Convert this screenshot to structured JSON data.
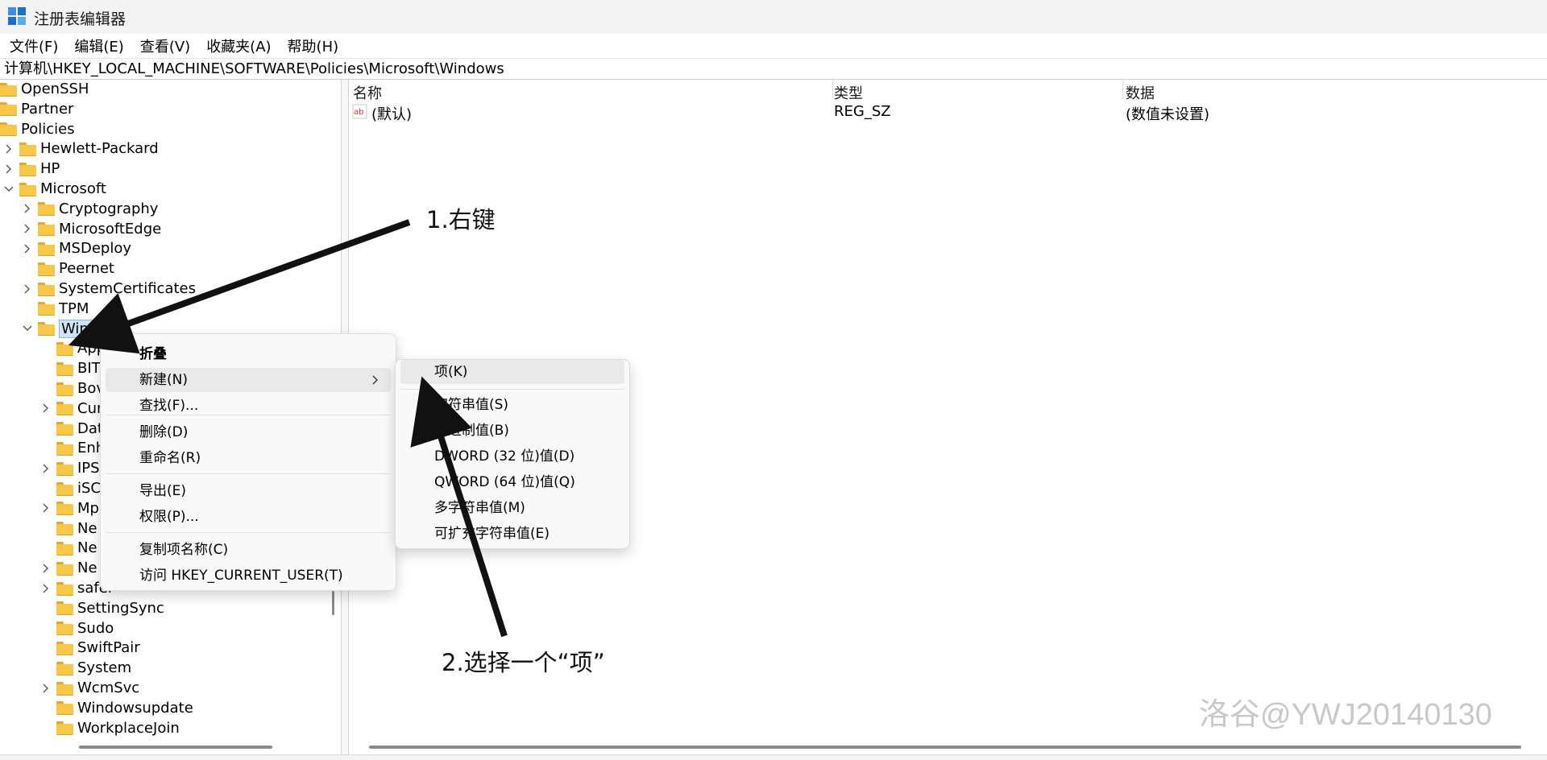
{
  "window": {
    "title": "注册表编辑器",
    "icon": "registry-editor-icon"
  },
  "menu": [
    {
      "label": "文件(F)"
    },
    {
      "label": "编辑(E)"
    },
    {
      "label": "查看(V)"
    },
    {
      "label": "收藏夹(A)"
    },
    {
      "label": "帮助(H)"
    }
  ],
  "address": "计算机\\HKEY_LOCAL_MACHINE\\SOFTWARE\\Policies\\Microsoft\\Windows",
  "tree": [
    {
      "label": "OpenSSH",
      "expander": "none"
    },
    {
      "label": "Partner",
      "expander": "none"
    },
    {
      "label": "Policies",
      "expander": "none"
    },
    {
      "label": "Hewlett-Packard",
      "expander": "collapsed"
    },
    {
      "label": "HP",
      "expander": "collapsed"
    },
    {
      "label": "Microsoft",
      "expander": "expanded"
    },
    {
      "label": "Cryptography",
      "expander": "collapsed"
    },
    {
      "label": "MicrosoftEdge",
      "expander": "collapsed"
    },
    {
      "label": "MSDeploy",
      "expander": "collapsed"
    },
    {
      "label": "Peernet",
      "expander": "none"
    },
    {
      "label": "SystemCertificates",
      "expander": "collapsed"
    },
    {
      "label": "TPM",
      "expander": "none"
    },
    {
      "label": "Windows",
      "expander": "expanded",
      "selected": true
    },
    {
      "label": "App",
      "expander": "none"
    },
    {
      "label": "BIT",
      "expander": "none"
    },
    {
      "label": "Bov",
      "expander": "none"
    },
    {
      "label": "Cur",
      "expander": "collapsed"
    },
    {
      "label": "Dat",
      "expander": "none"
    },
    {
      "label": "Enh",
      "expander": "none"
    },
    {
      "label": "IPS",
      "expander": "collapsed"
    },
    {
      "label": "iSC",
      "expander": "none"
    },
    {
      "label": "Mp",
      "expander": "collapsed"
    },
    {
      "label": "Ne",
      "expander": "none"
    },
    {
      "label": "Ne",
      "expander": "none"
    },
    {
      "label": "Ne",
      "expander": "collapsed"
    },
    {
      "label": "safer",
      "expander": "collapsed"
    },
    {
      "label": "SettingSync",
      "expander": "none"
    },
    {
      "label": "Sudo",
      "expander": "none"
    },
    {
      "label": "SwiftPair",
      "expander": "none"
    },
    {
      "label": "System",
      "expander": "none"
    },
    {
      "label": "WcmSvc",
      "expander": "collapsed"
    },
    {
      "label": "Windowsupdate",
      "expander": "none"
    },
    {
      "label": "WorkplaceJoin",
      "expander": "none"
    }
  ],
  "list": {
    "columns": [
      "名称",
      "类型",
      "数据"
    ],
    "rows": [
      {
        "name": "(默认)",
        "type": "REG_SZ",
        "data": "(数值未设置)",
        "icon": "string-value-icon"
      }
    ]
  },
  "context_menu": {
    "items": [
      {
        "label": "折叠",
        "bold": true
      },
      {
        "label": "新建(N)",
        "submenu": true
      },
      {
        "label": "查找(F)..."
      },
      {
        "label": "删除(D)"
      },
      {
        "label": "重命名(R)"
      },
      {
        "label": "导出(E)"
      },
      {
        "label": "权限(P)..."
      },
      {
        "label": "复制项名称(C)"
      },
      {
        "label": "访问 HKEY_CURRENT_USER(T)"
      }
    ]
  },
  "submenu": {
    "items": [
      {
        "label": "项(K)"
      },
      {
        "label": "字符串值(S)"
      },
      {
        "label": "二进制值(B)"
      },
      {
        "label": "DWORD (32 位)值(D)"
      },
      {
        "label": "QWORD (64 位)值(Q)"
      },
      {
        "label": "多字符串值(M)"
      },
      {
        "label": "可扩充字符串值(E)"
      }
    ]
  },
  "annotations": {
    "step1": "1.右键",
    "step2": "2.选择一个“项”"
  },
  "watermark": "洛谷@YWJ20140130",
  "colors": {
    "folder": "#f7c748",
    "selection": "#cde4f7",
    "menu_bg": "#f9f9f9"
  }
}
